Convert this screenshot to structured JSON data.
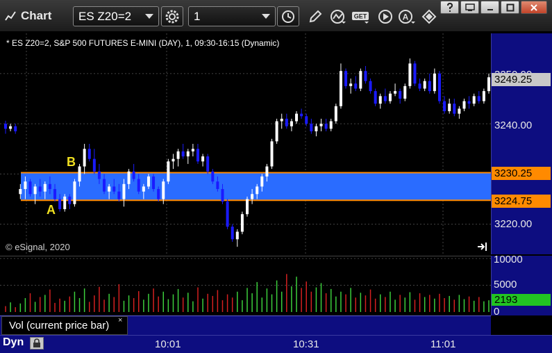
{
  "toolbar": {
    "title": "Chart",
    "symbol": "ES Z20=2",
    "interval": "1"
  },
  "chart": {
    "description": "* ES Z20=2, S&P 500 FUTURES E-MINI (DAY), 1, 09:30-16:15 (Dynamic)",
    "copyright": "© eSignal, 2020",
    "price_ticks": [
      "3250.00",
      "3240.00",
      "3220.00"
    ],
    "last_price": "3249.25",
    "band_upper": "3230.25",
    "band_lower": "3224.75",
    "band_label_a": "A",
    "band_label_b": "B",
    "colors": {
      "background": "#000000",
      "axis": "#0d0d80",
      "band": "#2a6cff",
      "band_line": "#ff8a00",
      "up": "#ffffff",
      "down": "#1a1aff",
      "vol_up": "#3ccf3c",
      "vol_down": "#d42020"
    }
  },
  "volume": {
    "ticks": [
      "10000",
      "5000",
      "0"
    ],
    "current": "2193",
    "study_label": "Vol (current price bar)",
    "close_glyph": "×"
  },
  "time_axis": {
    "dyn_label": "Dyn",
    "times": [
      "10:01",
      "10:31",
      "11:01"
    ]
  },
  "chart_data": {
    "type": "candlestick",
    "ylim": [
      3214,
      3258
    ],
    "bands": [
      {
        "low": 3224.75,
        "high": 3230.25
      }
    ],
    "candles": [
      [
        3240,
        3240.6,
        3238,
        3239
      ],
      [
        3239,
        3240,
        3238.5,
        3239.5
      ],
      [
        3239.5,
        3240,
        3238,
        3238.5
      ],
      [
        3226,
        3228,
        3225,
        3227
      ],
      [
        3227,
        3229.5,
        3225,
        3228.5
      ],
      [
        3228.5,
        3229,
        3225.5,
        3226
      ],
      [
        3226,
        3228,
        3224,
        3227.5
      ],
      [
        3227.5,
        3229,
        3225.5,
        3226.5
      ],
      [
        3226.5,
        3228.5,
        3225,
        3228
      ],
      [
        3228,
        3229.5,
        3226,
        3227
      ],
      [
        3227,
        3228,
        3224.5,
        3225
      ],
      [
        3225,
        3226,
        3222.5,
        3223
      ],
      [
        3223,
        3226,
        3222.5,
        3225.5
      ],
      [
        3225.5,
        3226,
        3223,
        3224
      ],
      [
        3224,
        3229,
        3223.5,
        3228.5
      ],
      [
        3228.5,
        3232,
        3227.5,
        3231.5
      ],
      [
        3231.5,
        3236,
        3230,
        3235
      ],
      [
        3235,
        3236,
        3232.5,
        3233
      ],
      [
        3233,
        3235,
        3230,
        3230.5
      ],
      [
        3230.5,
        3232,
        3228,
        3229
      ],
      [
        3229,
        3230,
        3226,
        3226.5
      ],
      [
        3226.5,
        3228,
        3225,
        3227.5
      ],
      [
        3227.5,
        3229,
        3226,
        3226.5
      ],
      [
        3226.5,
        3228,
        3224.5,
        3225
      ],
      [
        3225,
        3229,
        3223.5,
        3228
      ],
      [
        3228,
        3231,
        3227,
        3230.5
      ],
      [
        3230.5,
        3232,
        3228.5,
        3229
      ],
      [
        3229,
        3230,
        3226,
        3226.5
      ],
      [
        3226.5,
        3228,
        3225,
        3227.5
      ],
      [
        3227.5,
        3230,
        3227,
        3229.5
      ],
      [
        3229.5,
        3230,
        3226.5,
        3227
      ],
      [
        3227,
        3227.5,
        3224.5,
        3225
      ],
      [
        3225,
        3229,
        3224,
        3228.5
      ],
      [
        3228.5,
        3233,
        3228,
        3232.5
      ],
      [
        3232.5,
        3234,
        3231,
        3233
      ],
      [
        3233,
        3235,
        3231.5,
        3234.5
      ],
      [
        3234.5,
        3236,
        3233,
        3233.5
      ],
      [
        3233.5,
        3235,
        3232,
        3234.5
      ],
      [
        3234.5,
        3236,
        3233.5,
        3235
      ],
      [
        3235,
        3236,
        3232,
        3232.5
      ],
      [
        3232.5,
        3234,
        3231.5,
        3233.5
      ],
      [
        3233.5,
        3234,
        3230,
        3230.5
      ],
      [
        3230.5,
        3231,
        3228,
        3228.5
      ],
      [
        3228.5,
        3229.5,
        3226.5,
        3227
      ],
      [
        3227,
        3228,
        3224,
        3224.5
      ],
      [
        3224.5,
        3225,
        3219,
        3219.5
      ],
      [
        3219.5,
        3220,
        3216.5,
        3217
      ],
      [
        3217,
        3219,
        3215.5,
        3218.5
      ],
      [
        3218.5,
        3222.5,
        3218,
        3222
      ],
      [
        3222,
        3225.5,
        3221.5,
        3225
      ],
      [
        3225,
        3227,
        3224,
        3226
      ],
      [
        3226,
        3228,
        3225,
        3227.5
      ],
      [
        3227.5,
        3230,
        3226.5,
        3229.5
      ],
      [
        3229.5,
        3232,
        3228.5,
        3231.5
      ],
      [
        3231.5,
        3237,
        3231,
        3236.5
      ],
      [
        3236.5,
        3241,
        3236,
        3240.5
      ],
      [
        3240.5,
        3242,
        3239,
        3241
      ],
      [
        3241,
        3242,
        3239,
        3239.5
      ],
      [
        3239.5,
        3241,
        3238.5,
        3240.5
      ],
      [
        3240.5,
        3242.5,
        3240,
        3242
      ],
      [
        3242,
        3243,
        3241,
        3241.5
      ],
      [
        3241.5,
        3242,
        3239.5,
        3240
      ],
      [
        3240,
        3241,
        3238,
        3238.5
      ],
      [
        3238.5,
        3240,
        3237.5,
        3239.5
      ],
      [
        3239.5,
        3241,
        3238.5,
        3240
      ],
      [
        3240,
        3241,
        3238.5,
        3239
      ],
      [
        3239,
        3241,
        3238.5,
        3240.5
      ],
      [
        3240.5,
        3244,
        3240,
        3243.5
      ],
      [
        3243.5,
        3252,
        3243,
        3250.5
      ],
      [
        3250.5,
        3251,
        3247,
        3247.5
      ],
      [
        3247.5,
        3249,
        3246,
        3248
      ],
      [
        3248,
        3249.5,
        3246.5,
        3247
      ],
      [
        3247,
        3251,
        3246.5,
        3250.5
      ],
      [
        3250.5,
        3251.5,
        3248,
        3248.5
      ],
      [
        3248.5,
        3249,
        3246,
        3246.5
      ],
      [
        3246.5,
        3247,
        3243.5,
        3244
      ],
      [
        3244,
        3246,
        3243,
        3245.5
      ],
      [
        3245.5,
        3247,
        3244,
        3244.5
      ],
      [
        3244.5,
        3246.5,
        3244,
        3246
      ],
      [
        3246,
        3248,
        3245.5,
        3246.5
      ],
      [
        3246.5,
        3247,
        3244,
        3245
      ],
      [
        3245,
        3248,
        3244.5,
        3247.5
      ],
      [
        3247.5,
        3253,
        3247,
        3252
      ],
      [
        3252,
        3252.5,
        3247.5,
        3248
      ],
      [
        3248,
        3249,
        3246.5,
        3247
      ],
      [
        3247,
        3249,
        3246.5,
        3248.5
      ],
      [
        3248.5,
        3250,
        3246,
        3246.5
      ],
      [
        3246.5,
        3251,
        3246,
        3250
      ],
      [
        3250,
        3250.5,
        3244,
        3244.5
      ],
      [
        3244.5,
        3245.5,
        3242,
        3242.5
      ],
      [
        3242.5,
        3245,
        3242,
        3244
      ],
      [
        3244,
        3245,
        3241.5,
        3242
      ],
      [
        3242,
        3243.5,
        3241,
        3243
      ],
      [
        3243,
        3245,
        3242.5,
        3244.5
      ],
      [
        3244.5,
        3245.5,
        3243,
        3244
      ],
      [
        3244,
        3246,
        3243.5,
        3245.5
      ],
      [
        3245.5,
        3246.5,
        3244,
        3244.5
      ],
      [
        3244.5,
        3247,
        3244,
        3246.5
      ],
      [
        3246.5,
        3250,
        3246,
        3249.25
      ]
    ],
    "volume": [
      1100,
      1800,
      900,
      1600,
      2600,
      3500,
      1900,
      2800,
      3200,
      4200,
      1700,
      2500,
      2100,
      2900,
      3800,
      2600,
      4400,
      1900,
      3100,
      4700,
      2300,
      3400,
      2800,
      5200,
      2100,
      3100,
      2600,
      3900,
      2300,
      3400,
      4400,
      2900,
      3800,
      2400,
      3300,
      4300,
      2700,
      3600,
      2000,
      4600,
      2500,
      3400,
      3000,
      4100,
      2200,
      3300,
      2700,
      3800,
      2200,
      4500,
      3500,
      5600,
      2700,
      4400,
      3300,
      5900,
      3800,
      7100,
      4800,
      6600,
      4500,
      5700,
      3800,
      4600,
      5400,
      3500,
      4300,
      2900,
      3800,
      3300,
      4500,
      2700,
      3600,
      3100,
      4200,
      2500,
      3300,
      2800,
      3800,
      2300,
      3200,
      2700,
      3700,
      2300,
      3500,
      2800,
      3200,
      2500,
      3400,
      2600,
      3000,
      2300,
      3200,
      2400,
      2900,
      2100,
      2800,
      2000,
      2193
    ],
    "vylim": [
      0,
      10000
    ],
    "x_ticks": [
      "10:01",
      "10:31",
      "11:01"
    ]
  }
}
